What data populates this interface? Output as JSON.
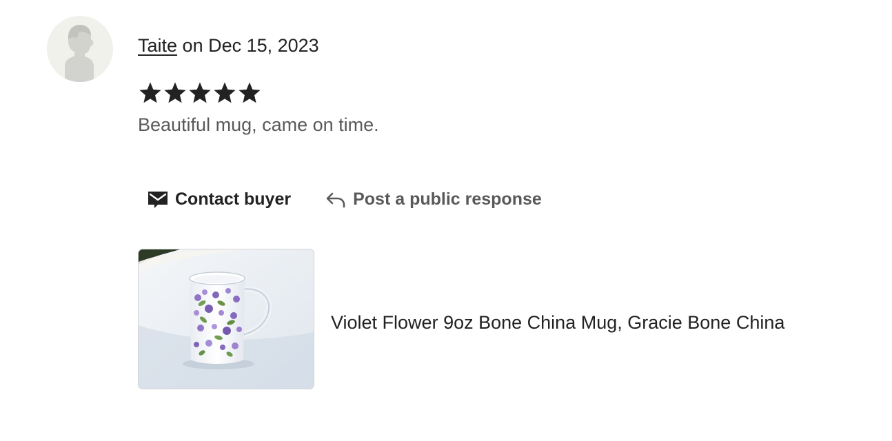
{
  "review": {
    "reviewer_name": "Taite",
    "date_text": " on Dec 15, 2023",
    "rating": 5,
    "rating_max": 5,
    "text": "Beautiful mug, came on time.",
    "avatar_icon": "default-user-silhouette-icon"
  },
  "actions": {
    "contact_label": "Contact buyer",
    "contact_icon": "envelope-icon",
    "response_label": "Post a public response",
    "response_icon": "reply-arrow-icon"
  },
  "listing": {
    "title": "Violet Flower 9oz Bone China Mug, Gracie Bone China",
    "image_icon": "floral-mug-photo"
  },
  "colors": {
    "text_primary": "#222222",
    "text_secondary": "#595959",
    "star": "#222222",
    "avatar_bg": "#f1f1ec",
    "thumb_border": "#d4d4d4"
  }
}
